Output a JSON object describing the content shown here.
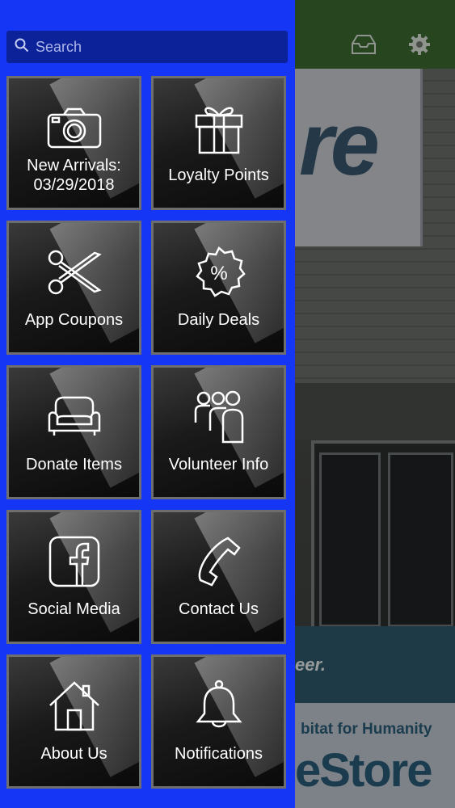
{
  "search": {
    "placeholder": "Search",
    "value": ""
  },
  "header_icons": [
    "inbox-icon",
    "gear-icon"
  ],
  "tiles": [
    {
      "label": "New Arrivals:",
      "label2": "03/29/2018",
      "icon": "camera-icon"
    },
    {
      "label": "Loyalty Points",
      "icon": "gift-icon"
    },
    {
      "label": "App Coupons",
      "icon": "scissors-icon"
    },
    {
      "label": "Daily Deals",
      "icon": "percent-badge-icon"
    },
    {
      "label": "Donate Items",
      "icon": "sofa-icon"
    },
    {
      "label": "Volunteer Info",
      "icon": "people-icon"
    },
    {
      "label": "Social Media",
      "icon": "facebook-icon"
    },
    {
      "label": "Contact Us",
      "icon": "phone-icon"
    },
    {
      "label": "About Us",
      "icon": "home-icon"
    },
    {
      "label": "Notifications",
      "icon": "bell-icon"
    }
  ],
  "background": {
    "sign_text": "re",
    "banner_text": "eer.",
    "habitat_text": "bitat for Humanity",
    "restore_text": "eStore"
  },
  "colors": {
    "drawer": "#1536f5",
    "search_bg": "#0b2298",
    "tile_border": "#6e6e6e"
  }
}
